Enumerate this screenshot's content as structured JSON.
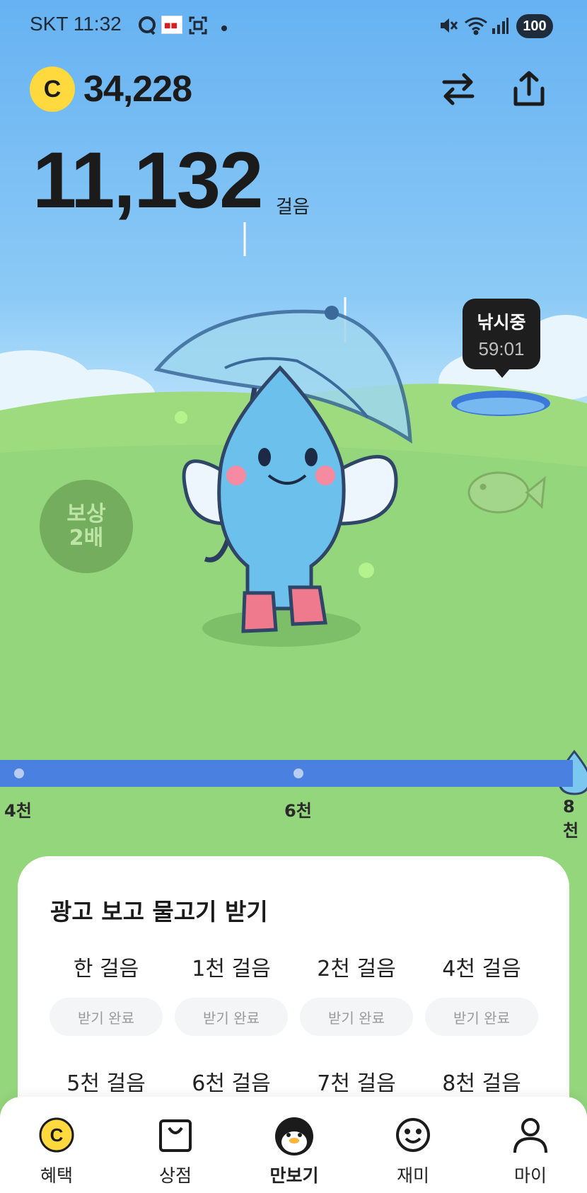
{
  "status_bar": {
    "carrier_time": "SKT 11:32",
    "battery": "100",
    "icons": [
      "chat-icon",
      "app-notification-icon",
      "screenshot-icon",
      "dot-icon",
      "mute-icon",
      "wifi-icon",
      "signal-icon"
    ]
  },
  "header": {
    "coin_symbol": "C",
    "coin_balance": "34,228",
    "icons": [
      "swap-icon",
      "share-icon"
    ]
  },
  "steps": {
    "count": "11,132",
    "unit": "걸음"
  },
  "fishing": {
    "status": "낚시중",
    "timer": "59:01"
  },
  "reward_badge": {
    "line1": "보상",
    "line2": "2배"
  },
  "progress": {
    "milestones": [
      "4천",
      "6천",
      "8천"
    ]
  },
  "ad_card": {
    "title": "광고 보고 물고기 받기",
    "row1": [
      {
        "label": "한 걸음",
        "button": "받기 완료"
      },
      {
        "label": "1천 걸음",
        "button": "받기 완료"
      },
      {
        "label": "2천 걸음",
        "button": "받기 완료"
      },
      {
        "label": "4천 걸음",
        "button": "받기 완료"
      }
    ],
    "row2": [
      {
        "label": "5천 걸음"
      },
      {
        "label": "6천 걸음"
      },
      {
        "label": "7천 걸음"
      },
      {
        "label": "8천 걸음"
      }
    ]
  },
  "bottom_nav": {
    "items": [
      {
        "label": "혜택",
        "icon": "coin-icon"
      },
      {
        "label": "상점",
        "icon": "shopping-bag-icon"
      },
      {
        "label": "만보기",
        "icon": "penguin-icon",
        "active": true
      },
      {
        "label": "재미",
        "icon": "smile-icon"
      },
      {
        "label": "마이",
        "icon": "person-icon"
      }
    ]
  },
  "colors": {
    "sky": "#66b2f2",
    "grass": "#8fd47a",
    "progress": "#4a80e0",
    "coin": "#ffd93d",
    "character": "#6cc0ec"
  }
}
